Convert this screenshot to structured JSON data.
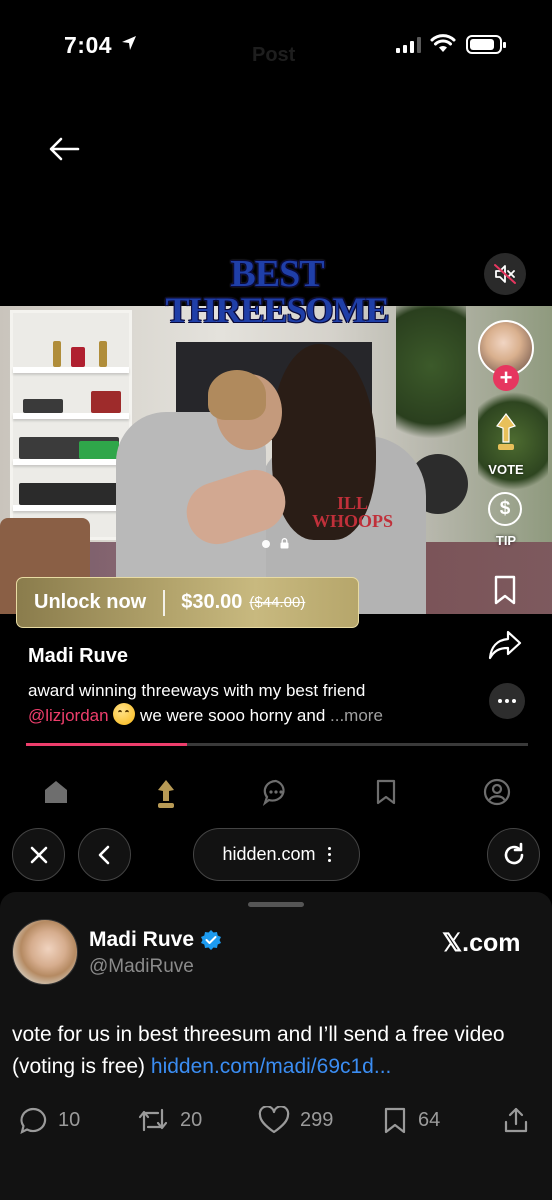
{
  "status_bar": {
    "time": "7:04",
    "faint_title": "Post"
  },
  "video": {
    "title_line1": "BEST",
    "title_line2": "THREESOME",
    "shirt_text_1": "ILL",
    "shirt_text_2": "WHOOPS"
  },
  "unlock": {
    "label": "Unlock now",
    "price": "$30.00",
    "original_price": "($44.00)"
  },
  "rail": {
    "vote_label": "VOTE",
    "tip_label": "TIP",
    "tip_symbol": "$"
  },
  "post": {
    "creator": "Madi Ruve",
    "caption_line1": "award winning threeways with my best friend",
    "mention": "@lizjordan",
    "caption_line2_rest": "we were sooo horny and",
    "more": "...more",
    "progress_fraction": 0.32
  },
  "app_nav": [
    "home-icon",
    "trophy-icon",
    "chat-icon",
    "bookmark-icon",
    "profile-icon"
  ],
  "browser": {
    "url": "hidden.com"
  },
  "tweet": {
    "name": "Madi Ruve",
    "handle": "@MadiRuve",
    "brand": "𝕏.com",
    "text": "vote for us in best threesum and I’ll send a free video (voting is free) ",
    "link": "hidden.com/madi/69c1d...",
    "replies": "10",
    "retweets": "20",
    "likes": "299",
    "bookmarks": "64"
  },
  "colors": {
    "accent": "#ee3e6c",
    "link": "#3b8df2",
    "gold": "#b3a46c",
    "title_blue": "#1f3fa8"
  }
}
